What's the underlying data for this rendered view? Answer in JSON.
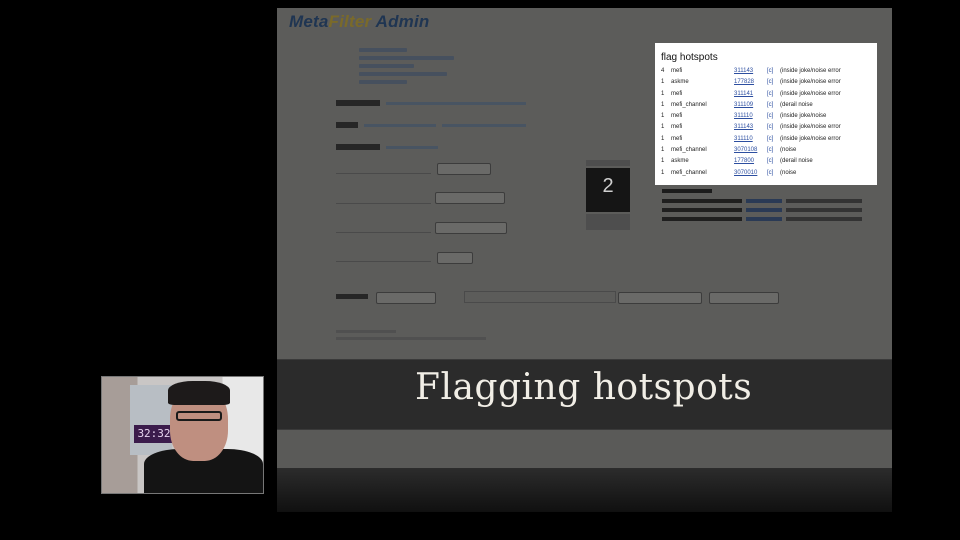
{
  "admin": {
    "logo_meta": "Meta",
    "logo_filter": "Filter",
    "logo_admin": "Admin"
  },
  "panel": {
    "title": "flag hotspots",
    "rows": [
      {
        "rank": "4",
        "user": "mefi",
        "link": "311143",
        "type": "[c]",
        "note": "(inside joke/noise error"
      },
      {
        "rank": "1",
        "user": "askme",
        "link": "177828",
        "type": "[c]",
        "note": "(inside joke/noise error"
      },
      {
        "rank": "1",
        "user": "mefi",
        "link": "311141",
        "type": "[c]",
        "note": "(inside joke/noise error"
      },
      {
        "rank": "1",
        "user": "mefi_channel",
        "link": "311109",
        "type": "[c]",
        "note": "(derail noise"
      },
      {
        "rank": "1",
        "user": "mefi",
        "link": "311110",
        "type": "[c]",
        "note": "(inside joke/noise"
      },
      {
        "rank": "1",
        "user": "mefi",
        "link": "311143",
        "type": "[c]",
        "note": "(inside joke/noise error"
      },
      {
        "rank": "1",
        "user": "mefi",
        "link": "311110",
        "type": "[c]",
        "note": "(inside joke/noise error"
      },
      {
        "rank": "1",
        "user": "mefi_channel",
        "link": "3070108",
        "type": "[c]",
        "note": "(noise"
      },
      {
        "rank": "1",
        "user": "askme",
        "link": "177800",
        "type": "[c]",
        "note": "(derail noise"
      },
      {
        "rank": "1",
        "user": "mefi_channel",
        "link": "3070010",
        "type": "[c]",
        "note": "(noise"
      }
    ]
  },
  "counter": {
    "value": "2"
  },
  "caption": {
    "text": "Flagging hotspots"
  },
  "webcam": {
    "clock": "32:32"
  }
}
